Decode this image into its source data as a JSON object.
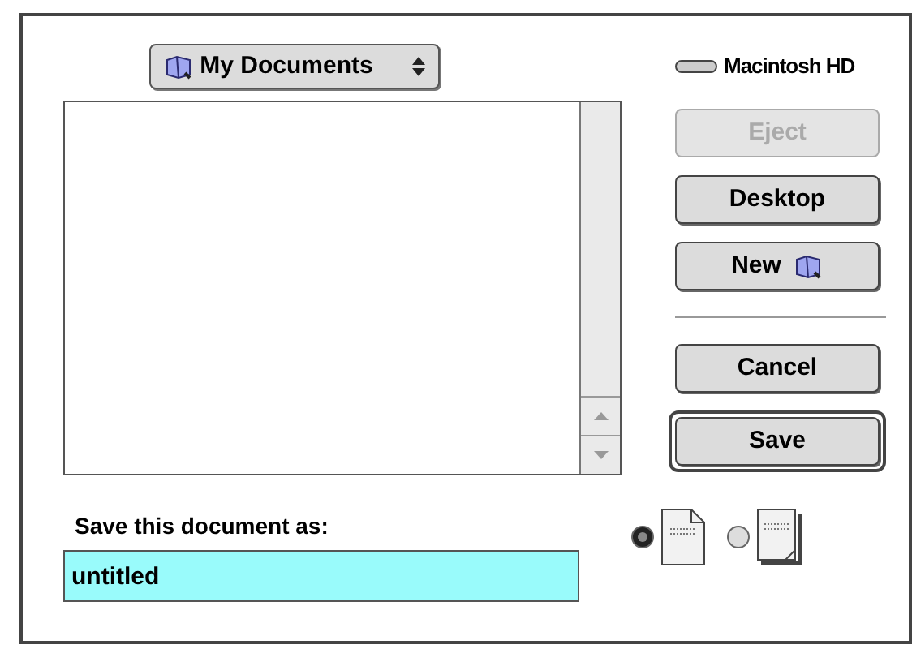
{
  "folder_menu": {
    "label": "My Documents"
  },
  "volume": {
    "name": "Macintosh HD"
  },
  "buttons": [
    {
      "label": "Eject",
      "disabled": true,
      "default": false
    },
    {
      "label": "Desktop",
      "disabled": false,
      "default": false
    },
    {
      "label": "New",
      "disabled": false,
      "default": false,
      "kind": "new-folder"
    },
    {
      "kind": "divider"
    },
    {
      "label": "Cancel",
      "disabled": false,
      "default": false
    },
    {
      "label": "Save",
      "disabled": false,
      "default": true
    }
  ],
  "name_field": {
    "label": "Save this document as:",
    "value": "untitled"
  },
  "formats": [
    {
      "kind": "document",
      "selected": true
    },
    {
      "kind": "stationery",
      "selected": false
    }
  ]
}
